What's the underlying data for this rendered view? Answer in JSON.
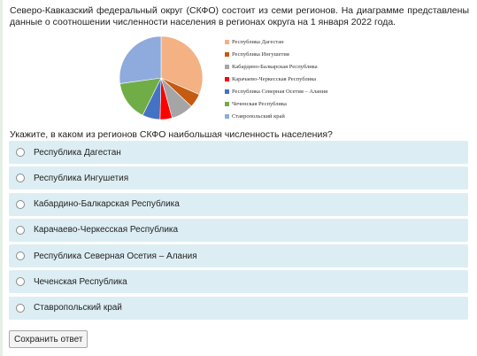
{
  "question": {
    "intro": "Северо-Кавказский федеральный округ (СКФО) состоит из семи регионов. На диаграмме представлены данные о соотношении численности населения в регионах округа на 1 января 2022 года.",
    "prompt": "Укажите, в каком из регионов СКФО наибольшая численность населения?"
  },
  "chart_data": {
    "type": "pie",
    "title": "",
    "categories": [
      "Республика Дагестан",
      "Республика Ингушетия",
      "Кабардино-Балкарская Республика",
      "Карачаево-Черкесская Республика",
      "Республика Северная Осетия – Алания",
      "Чеченская Республика",
      "Ставропольский край"
    ],
    "values": [
      31.5,
      5.5,
      8.7,
      4.7,
      6.9,
      15.5,
      27.2
    ],
    "colors": [
      "#f4b183",
      "#c55a11",
      "#a5a5a5",
      "#ff0000",
      "#4472c4",
      "#70ad47",
      "#8faadc"
    ],
    "legend": "right"
  },
  "options": [
    {
      "label": "Республика Дагестан"
    },
    {
      "label": "Республика Ингушетия"
    },
    {
      "label": "Кабардино-Балкарская Республика"
    },
    {
      "label": "Карачаево-Черкесская Республика"
    },
    {
      "label": "Республика Северная Осетия – Алания"
    },
    {
      "label": "Чеченская Республика"
    },
    {
      "label": "Ставропольский край"
    }
  ],
  "submit_label": "Сохранить ответ"
}
